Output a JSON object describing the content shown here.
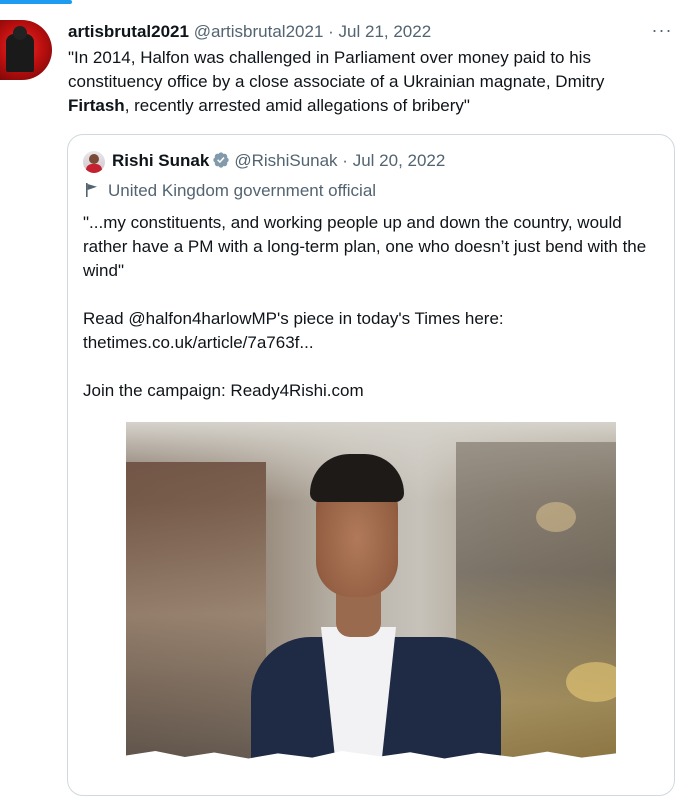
{
  "tweet": {
    "author_name": "artisbrutal2021",
    "handle": "@artisbrutal2021",
    "separator": "·",
    "date": "Jul 21, 2022",
    "more_label": "···",
    "text_part1": "\"In 2014, Halfon was challenged in Parliament over money paid to his constituency office by a close associate of a Ukrainian magnate, Dmitry ",
    "text_bold": "Firtash",
    "text_part2": ", recently arrested amid allegations of bribery\""
  },
  "quoted": {
    "author_name": "Rishi Sunak",
    "handle": "@RishiSunak",
    "separator": "·",
    "date": "Jul 20, 2022",
    "affiliation": "United Kingdom government official",
    "paragraph1": "\"...my constituents, and working people up and down the country, would rather have a PM with a long-term plan, one who doesn’t just bend with the wind\"",
    "paragraph2_line1": "Read @halfon4harlowMP's piece in today's Times here:",
    "paragraph2_line2": "thetimes.co.uk/article/7a763f...",
    "paragraph3": "Join the campaign: Ready4Rishi.com"
  },
  "colors": {
    "accent": "#1d9bf0",
    "secondary_text": "#536471",
    "border": "#cfd9de",
    "verified_badge": "#829aab"
  },
  "icons": {
    "more": "more-icon",
    "verified": "verified-badge-icon",
    "affiliation": "flag-icon"
  }
}
